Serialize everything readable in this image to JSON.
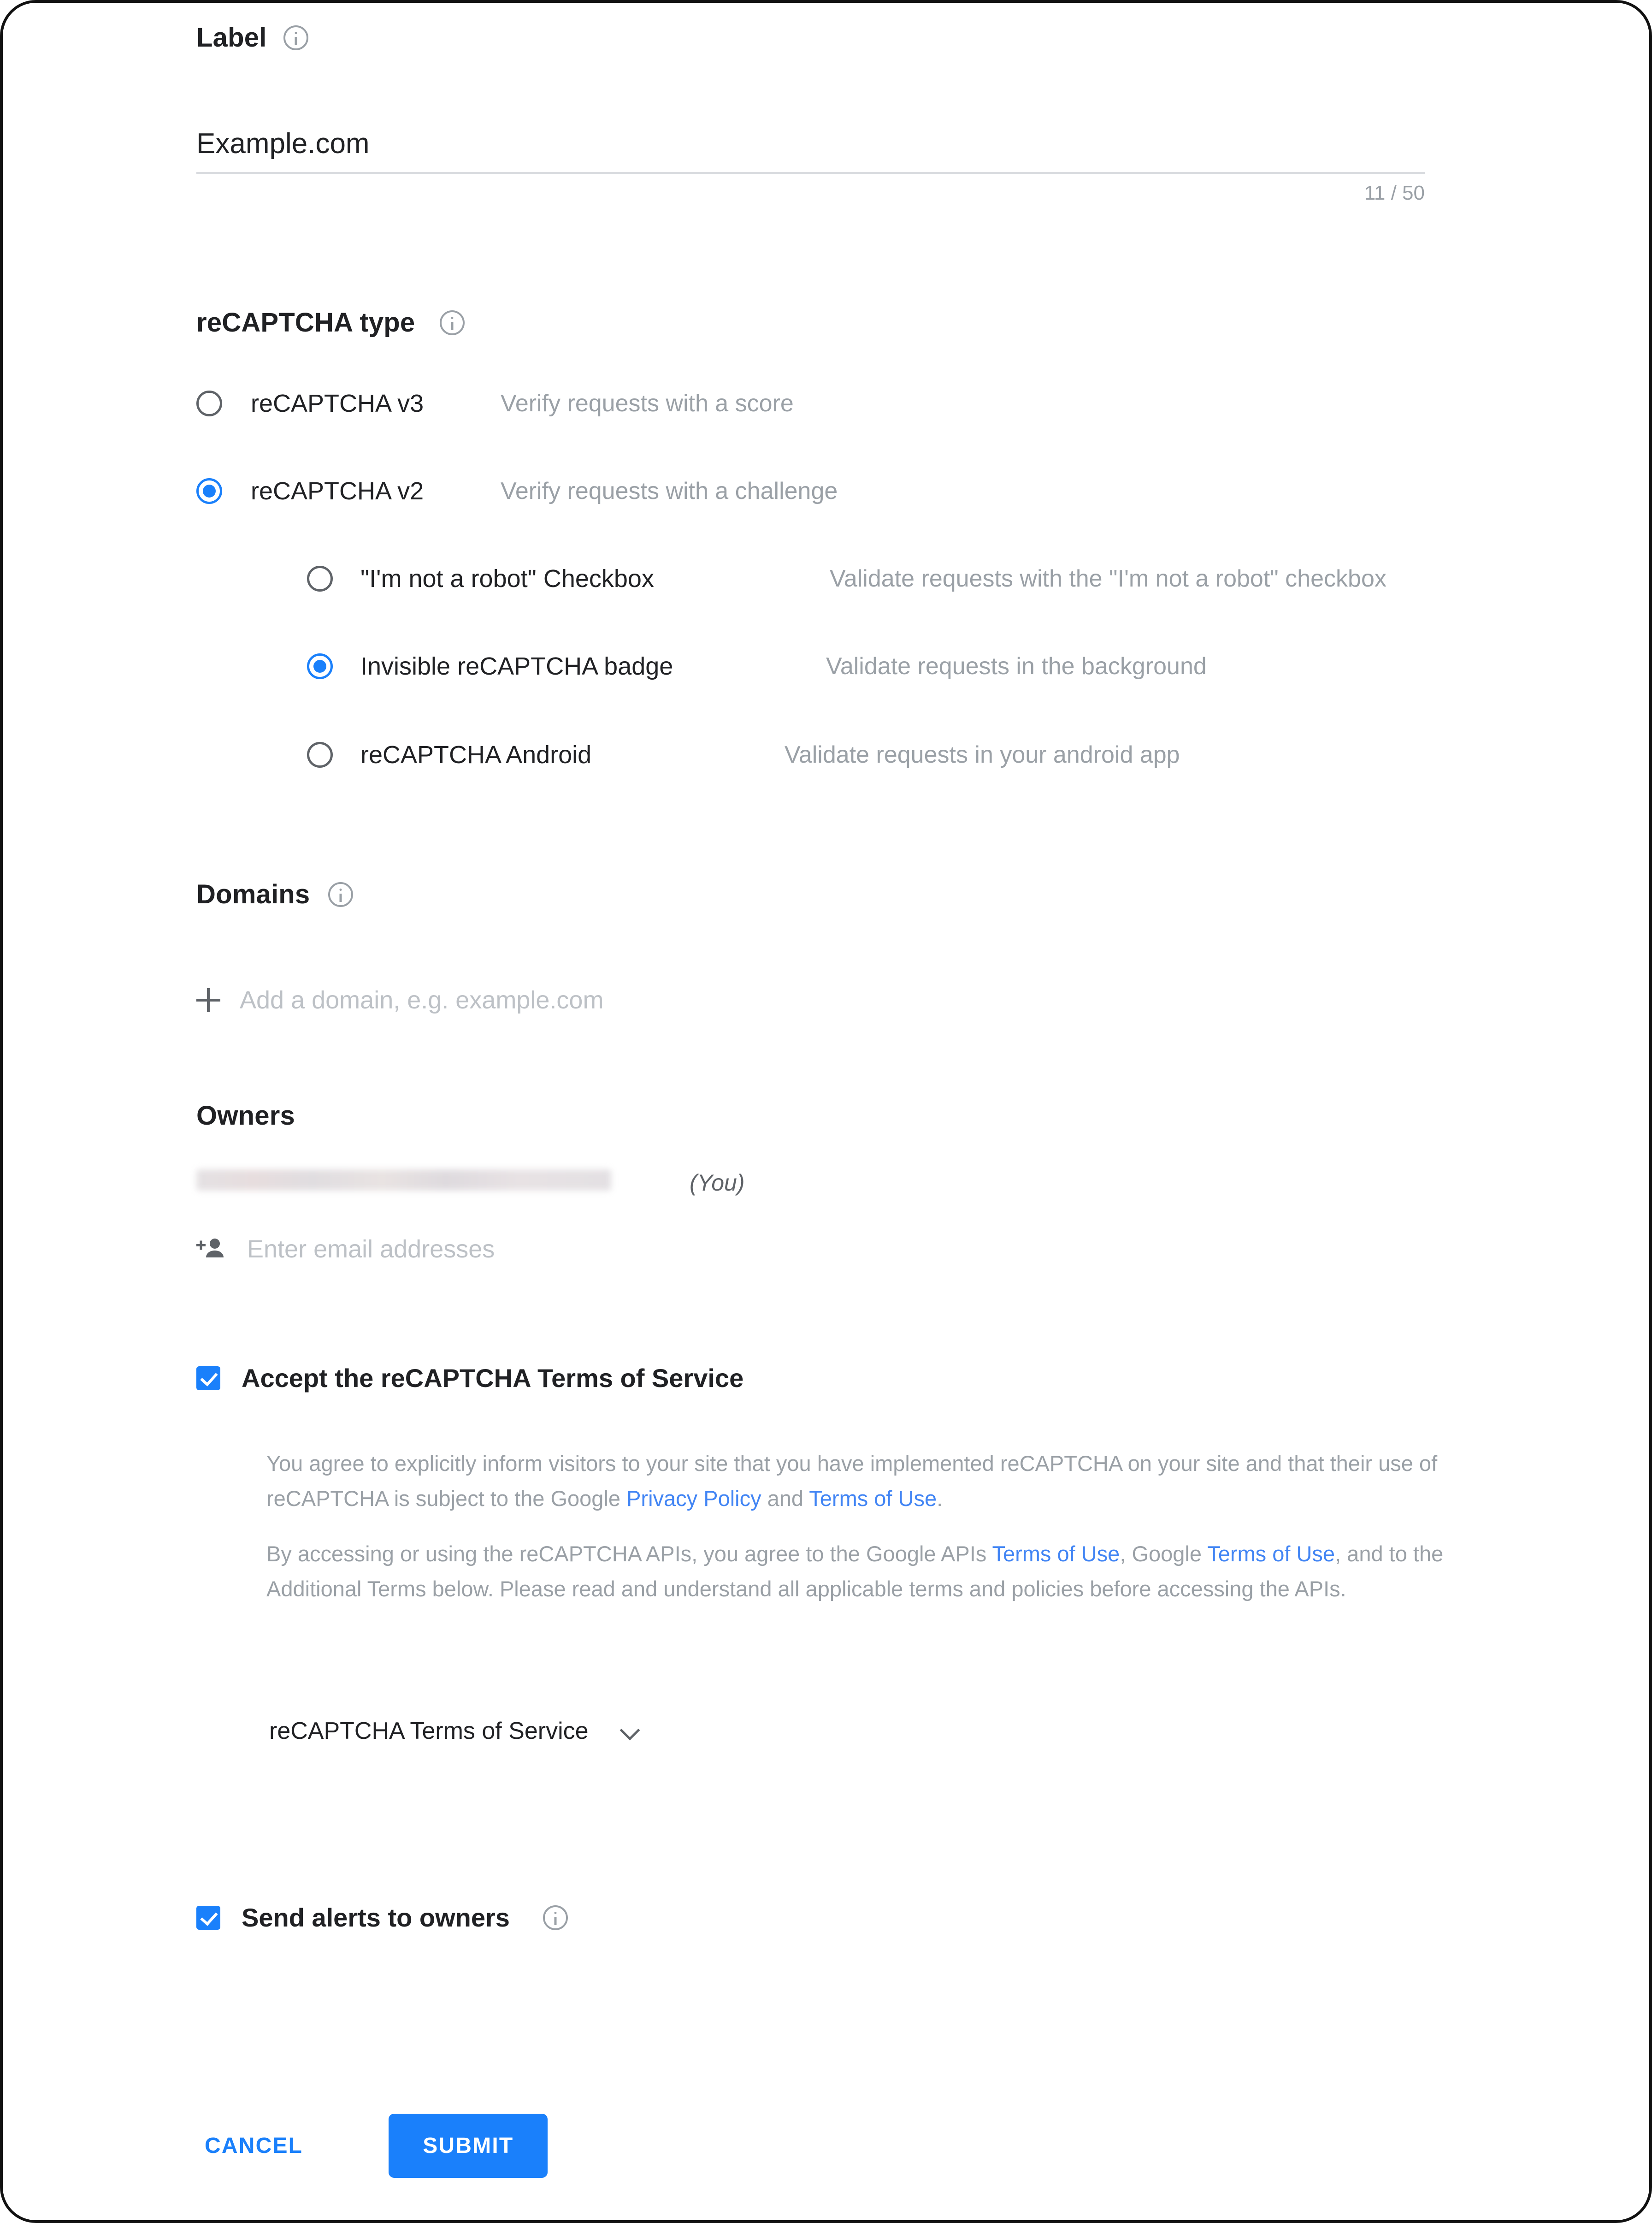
{
  "label_section": {
    "title": "Label",
    "info_icon": "info-icon",
    "value": "Example.com",
    "placeholder": "Label",
    "char_counter": "11 / 50"
  },
  "recaptcha_type": {
    "title": "reCAPTCHA type",
    "info_icon": "info-icon",
    "options": [
      {
        "label": "reCAPTCHA v3",
        "description": "Verify requests with a score",
        "checked": false
      },
      {
        "label": "reCAPTCHA v2",
        "description": "Verify requests with a challenge",
        "checked": true
      }
    ],
    "sub_options": [
      {
        "label": "\"I'm not a robot\" Checkbox",
        "description": "Validate requests with the \"I'm not a robot\" checkbox",
        "checked": false
      },
      {
        "label": "Invisible reCAPTCHA badge",
        "description": "Validate requests in the background",
        "checked": true
      },
      {
        "label": "reCAPTCHA Android",
        "description": "Validate requests in your android app",
        "checked": false
      }
    ]
  },
  "domains": {
    "title": "Domains",
    "info_icon": "info-icon",
    "add_icon": "plus-icon",
    "add_placeholder": "Add a domain, e.g. example.com"
  },
  "owners": {
    "title": "Owners",
    "existing_owner_redacted": "",
    "you_tag": "(You)",
    "add_icon": "person-add-icon",
    "add_placeholder": "Enter email addresses"
  },
  "terms": {
    "accept_label": "Accept the reCAPTCHA Terms of Service",
    "accepted": true,
    "paragraph1_part1": "You agree to explicitly inform visitors to your site that you have implemented reCAPTCHA on your site and that their use of reCAPTCHA is subject to the Google ",
    "paragraph1_link1": "Privacy Policy",
    "paragraph1_part2": " and ",
    "paragraph1_link2": "Terms of Use",
    "paragraph1_part3": ".",
    "paragraph2_part1": "By accessing or using the reCAPTCHA APIs, you agree to the Google APIs ",
    "paragraph2_link1": "Terms of Use",
    "paragraph2_part2": ", Google ",
    "paragraph2_link2": "Terms of Use",
    "paragraph2_part3": ", and to the Additional Terms below. Please read and understand all applicable terms and policies before accessing the APIs.",
    "expander_label": "reCAPTCHA Terms of Service",
    "expander_icon": "chevron-down-icon"
  },
  "alerts": {
    "label": "Send alerts to owners",
    "checked": true,
    "info_icon": "info-icon"
  },
  "actions": {
    "cancel_label": "CANCEL",
    "submit_label": "SUBMIT"
  },
  "colors": {
    "accent": "#1a80fb",
    "link": "#4285f4",
    "text": "#202124",
    "muted": "#9aa0a6",
    "placeholder": "#bdc1c6",
    "divider": "#dadce0"
  }
}
